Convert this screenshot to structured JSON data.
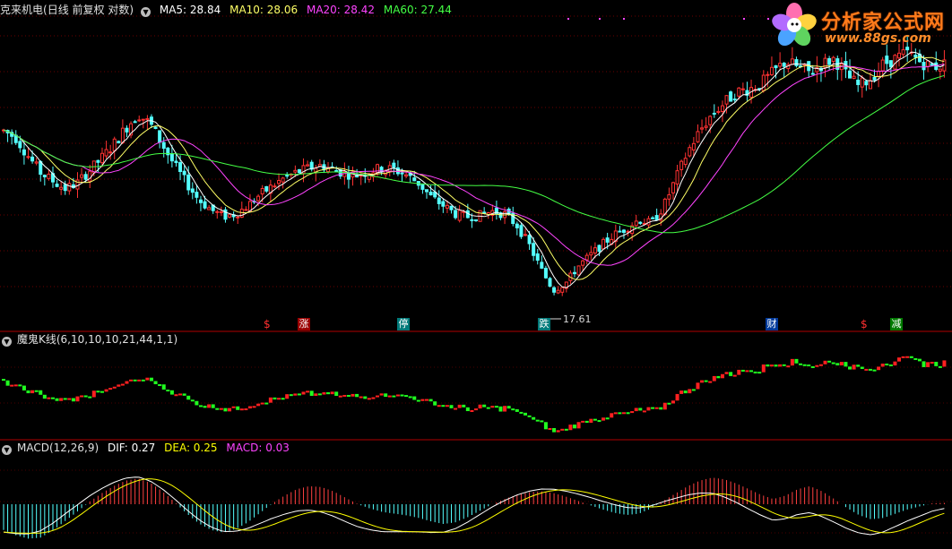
{
  "main": {
    "stock_name": "克来机电",
    "period_info": "(日线 前复权 对数)",
    "ma": [
      {
        "label": "MA5: 28.84",
        "color": "#ffffff"
      },
      {
        "label": "MA10: 28.06",
        "color": "#ffff66"
      },
      {
        "label": "MA20: 28.42",
        "color": "#ff44ff"
      },
      {
        "label": "MA60: 27.44",
        "color": "#44ff44"
      }
    ],
    "low_marker": "17.61"
  },
  "signals": [
    {
      "text": "$",
      "color": "#ff3030"
    },
    {
      "text": "涨",
      "color": "#ffffff",
      "bg": "#9a0000"
    },
    {
      "text": "停",
      "color": "#ffffff",
      "bg": "#007a7a"
    },
    {
      "text": "跌",
      "color": "#ffffff",
      "bg": "#007a7a"
    },
    {
      "text": "财",
      "color": "#ffffff",
      "bg": "#003a9a"
    },
    {
      "text": "$",
      "color": "#ff3030"
    },
    {
      "text": "减",
      "color": "#ffffff",
      "bg": "#007a00"
    }
  ],
  "k_panel": {
    "title": "魔鬼K线(6,10,10,10,21,44,1,1)"
  },
  "macd_panel": {
    "title": "MACD(12,26,9)",
    "dif": "DIF: 0.27",
    "dea": "DEA: 0.25",
    "macd": "MACD: 0.03",
    "colors": {
      "dif": "#ffffff",
      "dea": "#ffff00",
      "macd": "#ff44ff"
    }
  },
  "logo": {
    "name": "分析家公式网",
    "url": "www.88gs.com"
  },
  "chart_data": [
    {
      "type": "candlestick",
      "series": [
        {
          "name": "price",
          "values": [
            30.0,
            29.5,
            28.2,
            27.0,
            26.4,
            25.8,
            26.2,
            27.1,
            28.0,
            29.0,
            30.2,
            31.2,
            30.5,
            29.0,
            27.5,
            26.2,
            25.0,
            24.3,
            23.8,
            24.0,
            24.6,
            25.4,
            26.0,
            26.6,
            27.0,
            27.3,
            27.5,
            27.2,
            26.9,
            26.8,
            27.1,
            27.3,
            27.2,
            26.8,
            26.2,
            25.2,
            24.6,
            24.0,
            23.8,
            23.9,
            24.2,
            24.0,
            23.2,
            21.8,
            20.0,
            18.5,
            19.0,
            20.2,
            21.0,
            21.8,
            22.5,
            23.0,
            23.6,
            23.3,
            24.5,
            26.5,
            28.5,
            30.0,
            31.2,
            32.0,
            32.8,
            33.0,
            33.4,
            34.2,
            35.0,
            34.6,
            34.2,
            34.8,
            35.2,
            34.0,
            33.2,
            33.8,
            34.8,
            35.2,
            35.6,
            35.0,
            34.6,
            34.8
          ]
        }
      ],
      "low_label": "17.61",
      "ma_series": [
        "MA5: 28.84",
        "MA10: 28.06",
        "MA20: 28.42",
        "MA60: 27.44"
      ]
    },
    {
      "type": "bar",
      "title": "魔鬼K线(6,10,10,10,21,44,1,1)"
    },
    {
      "type": "bar",
      "title": "MACD(12,26,9)",
      "series": [
        {
          "name": "DIF: 0.27"
        },
        {
          "name": "DEA: 0.25"
        },
        {
          "name": "MACD: 0.03"
        }
      ],
      "hist": [
        -0.6,
        -0.72,
        -0.8,
        -0.78,
        -0.62,
        -0.4,
        -0.18,
        0.05,
        0.25,
        0.42,
        0.55,
        0.6,
        0.5,
        0.3,
        0.05,
        -0.22,
        -0.45,
        -0.6,
        -0.66,
        -0.58,
        -0.42,
        -0.2,
        0.02,
        0.2,
        0.35,
        0.42,
        0.4,
        0.3,
        0.15,
        0.0,
        -0.1,
        -0.18,
        -0.22,
        -0.26,
        -0.32,
        -0.4,
        -0.46,
        -0.42,
        -0.3,
        -0.15,
        0.0,
        0.12,
        0.22,
        0.28,
        0.3,
        0.26,
        0.18,
        0.08,
        -0.02,
        -0.12,
        -0.2,
        -0.25,
        -0.22,
        -0.1,
        0.08,
        0.25,
        0.42,
        0.55,
        0.62,
        0.58,
        0.48,
        0.35,
        0.22,
        0.12,
        0.2,
        0.35,
        0.42,
        0.3,
        0.12,
        -0.08,
        -0.25,
        -0.35,
        -0.32,
        -0.22,
        -0.12,
        -0.05,
        0.02,
        0.03
      ]
    }
  ]
}
